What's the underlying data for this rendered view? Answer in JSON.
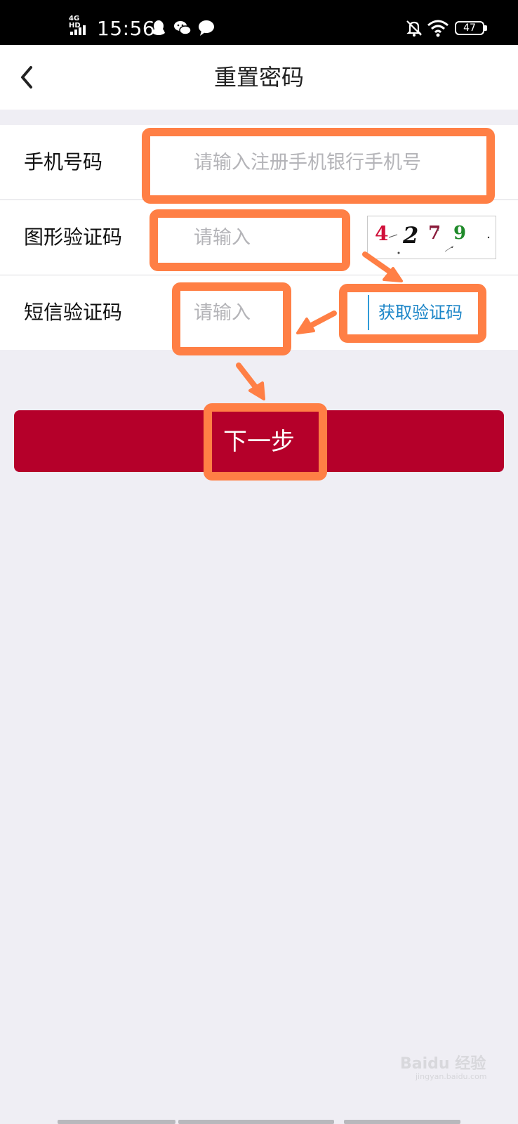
{
  "status_bar": {
    "network": "4G HD",
    "time": "15:56",
    "battery": "47",
    "icons": [
      "qq-icon",
      "wechat-icon",
      "message-icon",
      "silent-bell-icon",
      "wifi-icon",
      "battery-icon"
    ]
  },
  "header": {
    "title": "重置密码",
    "back_icon": "chevron-left-icon"
  },
  "form": {
    "phone": {
      "label": "手机号码",
      "placeholder": "请输入注册手机银行手机号",
      "value": ""
    },
    "captcha": {
      "label": "图形验证码",
      "placeholder": "请输入",
      "value": "",
      "image_text": "4 2 7 9"
    },
    "sms": {
      "label": "短信验证码",
      "placeholder": "请输入",
      "value": "",
      "button": "获取验证码"
    }
  },
  "next_button": "下一步",
  "watermark": {
    "text": "Baidu 经验",
    "sub": "jingyan.baidu.com"
  },
  "colors": {
    "accent": "#b5002a",
    "highlight": "#ff7f45",
    "link": "#1d86c8",
    "background": "#efeef4"
  }
}
